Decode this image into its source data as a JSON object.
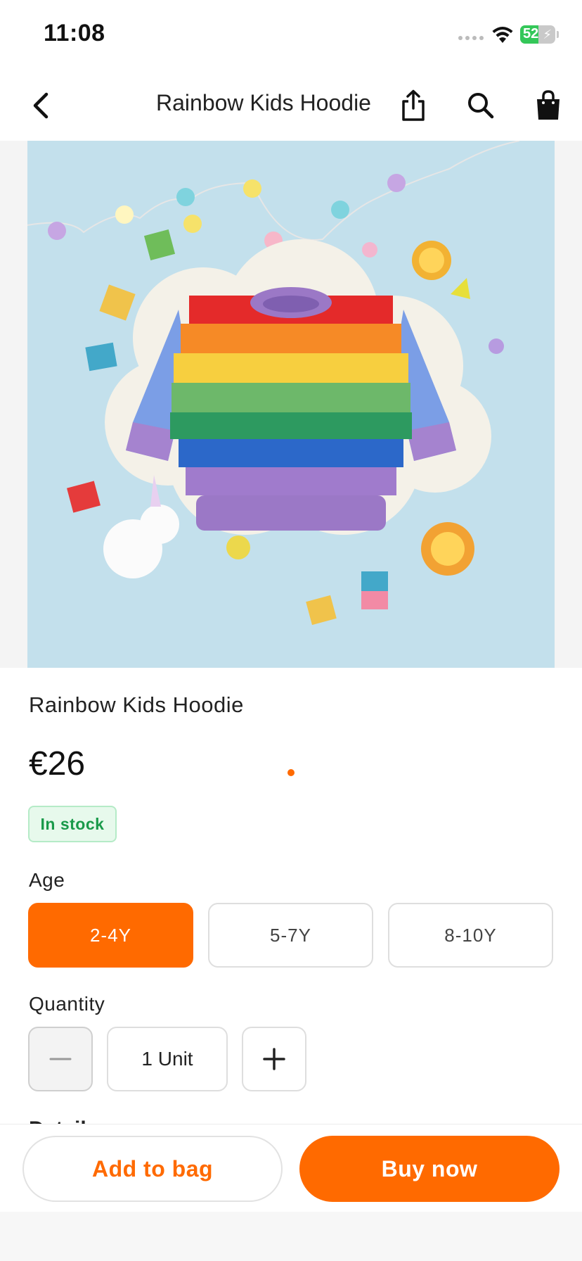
{
  "status_bar": {
    "time": "11:08",
    "battery_percent": "52"
  },
  "nav": {
    "title": "Rainbow Kids Hoodie"
  },
  "gallery": {
    "image_alt": "Rainbow knitted kids sweater",
    "image_count": 1,
    "current_index": 1
  },
  "product": {
    "name": "Rainbow Kids Hoodie",
    "price": "€26",
    "stock_status": "In stock"
  },
  "age": {
    "label": "Age",
    "options": [
      "2-4Y",
      "5-7Y",
      "8-10Y"
    ],
    "selected": "2-4Y"
  },
  "quantity": {
    "label": "Quantity",
    "value": "1 Unit"
  },
  "details": {
    "label": "Details"
  },
  "actions": {
    "add_to_bag": "Add to bag",
    "buy_now": "Buy now"
  },
  "colors": {
    "accent": "#ff6a00",
    "stock_text": "#1a9a4a",
    "stock_bg": "#e7f9ec"
  }
}
